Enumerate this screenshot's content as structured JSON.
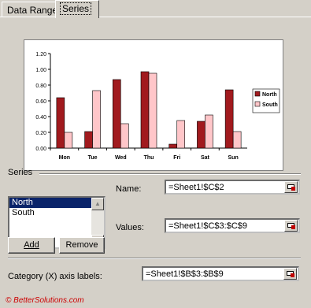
{
  "tabs": [
    {
      "label": "Data Range",
      "active": false
    },
    {
      "label": "Series",
      "active": true
    }
  ],
  "chart_data": {
    "type": "bar",
    "categories": [
      "Mon",
      "Tue",
      "Wed",
      "Thu",
      "Fri",
      "Sat",
      "Sun"
    ],
    "series": [
      {
        "name": "North",
        "color": "#a11a1e",
        "values": [
          0.64,
          0.21,
          0.87,
          0.97,
          0.05,
          0.34,
          0.74
        ]
      },
      {
        "name": "South",
        "color": "#ffc6c9",
        "values": [
          0.2,
          0.73,
          0.31,
          0.95,
          0.35,
          0.42,
          0.21
        ]
      }
    ],
    "ylim": [
      0,
      1.2
    ],
    "yticks": [
      "0.00",
      "0.20",
      "0.40",
      "0.60",
      "0.80",
      "1.00",
      "1.20"
    ],
    "legend": "right",
    "grid": false
  },
  "series_section": {
    "label": "Series",
    "items": [
      "North",
      "South"
    ],
    "selected": "North"
  },
  "buttons": {
    "add": "Add",
    "remove": "Remove"
  },
  "fields": {
    "name_label": "Name:",
    "name_value": "=Sheet1!$C$2",
    "values_label": "Values:",
    "values_value": "=Sheet1!$C$3:$C$9",
    "category_label": "Category (X) axis labels:",
    "category_value": "=Sheet1!$B$3:$B$9"
  },
  "footer": "© BetterSolutions.com"
}
